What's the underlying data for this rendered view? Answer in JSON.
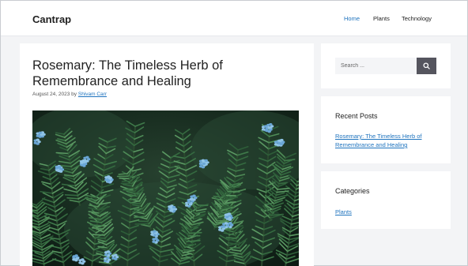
{
  "header": {
    "site_title": "Cantrap",
    "nav": [
      {
        "label": "Home",
        "active": true
      },
      {
        "label": "Plants",
        "active": false
      },
      {
        "label": "Technology",
        "active": false
      }
    ]
  },
  "post": {
    "title": "Rosemary: The Timeless Herb of Remembrance and Healing",
    "date": "August 24, 2023",
    "by": "by",
    "author": "Shivam Carr",
    "image_description_icon": "rosemary-photo"
  },
  "sidebar": {
    "search": {
      "placeholder": "Search ...",
      "icon": "search-icon"
    },
    "recent_posts": {
      "title": "Recent Posts",
      "items": [
        "Rosemary: The Timeless Herb of Remembrance and Healing"
      ]
    },
    "categories": {
      "title": "Categories",
      "items": [
        "Plants"
      ]
    }
  },
  "colors": {
    "accent": "#1e73be",
    "page_background": "#f3f4f6",
    "search_button": "#55555e"
  }
}
